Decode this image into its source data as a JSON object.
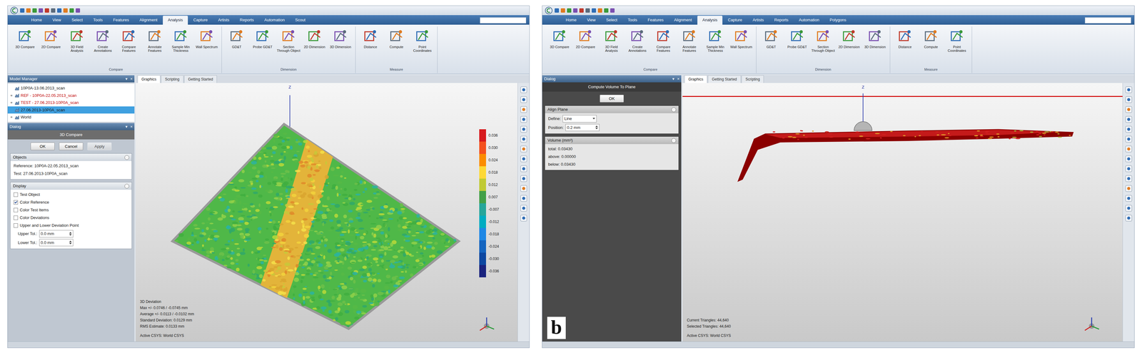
{
  "panel_a": {
    "menu_tabs": [
      {
        "label": "Home",
        "selected": false
      },
      {
        "label": "View",
        "selected": false
      },
      {
        "label": "Select",
        "selected": false
      },
      {
        "label": "Tools",
        "selected": false
      },
      {
        "label": "Features",
        "selected": false
      },
      {
        "label": "Alignment",
        "selected": false
      },
      {
        "label": "Analysis",
        "selected": true
      },
      {
        "label": "Capture",
        "selected": false
      },
      {
        "label": "Artists",
        "selected": false
      },
      {
        "label": "Reports",
        "selected": false
      },
      {
        "label": "Automation",
        "selected": false
      },
      {
        "label": "Scout",
        "selected": false
      }
    ],
    "ribbon_groups": [
      {
        "title": "Compare",
        "buttons": [
          "3D Compare",
          "2D Compare",
          "3D Field Analysis",
          "Create Annotations",
          "Compare Features",
          "Annotate Features",
          "Sample Min Thickness",
          "Wall Spectrum"
        ]
      },
      {
        "title": "Dimension",
        "buttons": [
          "GD&T",
          "Probe GD&T",
          "Section Through Object",
          "2D Dimension",
          "3D Dimension"
        ]
      },
      {
        "title": "Measure",
        "buttons": [
          "Distance",
          "Compute",
          "Point Coordinates"
        ]
      }
    ],
    "model_manager": {
      "title": "Model Manager",
      "controls": [
        "▾",
        "×"
      ],
      "items": [
        {
          "label": "10P0A-13.06.2013_scan",
          "color": "#1a1a1a",
          "selected": false
        },
        {
          "label": "REF - 10P0A-22.05.2013_scan",
          "color": "#c00000",
          "selected": false,
          "expander": "+"
        },
        {
          "label": "TEST - 27.06.2013-10P0A_scan",
          "color": "#c00000",
          "selected": false,
          "expander": "+"
        },
        {
          "label": "27.06.2013-10P0A_scan",
          "color": "#1a1a1a",
          "selected": true
        },
        {
          "label": "World",
          "color": "#1a1a1a",
          "selected": false,
          "expander": "+"
        }
      ]
    },
    "dialog": {
      "title": "Dialog",
      "controls": [
        "▾",
        "×"
      ],
      "name": "3D Compare",
      "buttons": [
        {
          "label": "OK",
          "disabled": false
        },
        {
          "label": "Cancel",
          "disabled": false
        },
        {
          "label": "Apply",
          "disabled": true
        }
      ],
      "sections": [
        {
          "title": "Objects",
          "rows": [
            {
              "kind": "text",
              "label": "Reference: 10P0A-22.05.2013_scan"
            },
            {
              "kind": "text",
              "label": "Test: 27.06.2013-10P0A_scan"
            }
          ]
        },
        {
          "title": "Display",
          "rows": [
            {
              "kind": "checkbox",
              "label": "Test Object",
              "checked": false
            },
            {
              "kind": "checkbox",
              "label": "Color Reference",
              "checked": true
            },
            {
              "kind": "checkbox",
              "label": "Color Test Items",
              "checked": false
            },
            {
              "kind": "checkbox",
              "label": "Color Deviations",
              "checked": false
            },
            {
              "kind": "checkbox",
              "label": "Upper and Lower Deviation Point",
              "checked": false
            },
            {
              "kind": "spin",
              "label": "Upper Tol.:",
              "value": "0.0 mm"
            },
            {
              "kind": "spin",
              "label": "Lower Tol.:",
              "value": "0.0 mm"
            }
          ]
        }
      ]
    },
    "graphics_tabs": [
      {
        "label": "Graphics",
        "selected": true
      },
      {
        "label": "Scripting",
        "selected": false
      },
      {
        "label": "Getting Started",
        "selected": false
      }
    ],
    "axis_label": "Z",
    "legend": [
      {
        "value": "0.036",
        "color": "#d7191c"
      },
      {
        "value": "0.030",
        "color": "#f4511e"
      },
      {
        "value": "0.024",
        "color": "#fb8c00"
      },
      {
        "value": "0.018",
        "color": "#fdd835"
      },
      {
        "value": "0.012",
        "color": "#c0ca33"
      },
      {
        "value": "0.007",
        "color": "#43a047"
      },
      {
        "value": "-0.007",
        "color": "#26a69a"
      },
      {
        "value": "-0.012",
        "color": "#00acc1"
      },
      {
        "value": "-0.018",
        "color": "#1e88e5"
      },
      {
        "value": "-0.024",
        "color": "#1565c0"
      },
      {
        "value": "-0.030",
        "color": "#0d47a1"
      },
      {
        "value": "-0.036",
        "color": "#1a237e"
      }
    ],
    "stats": [
      "3D Deviation",
      "Max +/- 0.0746 / -0.0745 mm",
      "Average +/- 0.0113 / -0.0102 mm",
      "Standard Deviation: 0.0129 mm",
      "RMS Estimate: 0.0133 mm"
    ],
    "footer": "Active CSYS: World CSYS"
  },
  "panel_b": {
    "menu_tabs": [
      {
        "label": "Home",
        "selected": false
      },
      {
        "label": "View",
        "selected": false
      },
      {
        "label": "Select",
        "selected": false
      },
      {
        "label": "Tools",
        "selected": false
      },
      {
        "label": "Features",
        "selected": false
      },
      {
        "label": "Alignment",
        "selected": false
      },
      {
        "label": "Analysis",
        "selected": true
      },
      {
        "label": "Capture",
        "selected": false
      },
      {
        "label": "Artists",
        "selected": false
      },
      {
        "label": "Reports",
        "selected": false
      },
      {
        "label": "Automation",
        "selected": false
      },
      {
        "label": "Polygons",
        "selected": false
      }
    ],
    "ribbon_groups": [
      {
        "title": "Compare",
        "buttons": [
          "3D Compare",
          "2D Compare",
          "3D Field Analysis",
          "Create Annotations",
          "Compare Features",
          "Annotate Features",
          "Sample Min Thickness",
          "Wall Spectrum"
        ]
      },
      {
        "title": "Dimension",
        "buttons": [
          "GD&T",
          "Probe GD&T",
          "Section Through Object",
          "2D Dimension",
          "3D Dimension"
        ]
      },
      {
        "title": "Measure",
        "buttons": [
          "Distance",
          "Compute",
          "Point Coordinates"
        ]
      }
    ],
    "dialog": {
      "title": "Dialog",
      "controls": [
        "▾",
        "×"
      ],
      "name": "Compute Volume To Plane",
      "buttons": [
        {
          "label": "OK",
          "disabled": false
        }
      ],
      "sections": [
        {
          "title": "Align Plane",
          "rows": [
            {
              "kind": "select",
              "label": "Define:",
              "value": "Line"
            },
            {
              "kind": "spin",
              "label": "Position:",
              "value": "0.2 mm"
            }
          ]
        },
        {
          "title": "Volume (mm³)",
          "rows": [
            {
              "kind": "text",
              "label": "total: 0.03430"
            },
            {
              "kind": "text",
              "label": "above: 0.00000"
            },
            {
              "kind": "text",
              "label": "below: 0.03430"
            }
          ]
        }
      ]
    },
    "graphics_tabs": [
      {
        "label": "Graphics",
        "selected": true
      },
      {
        "label": "Getting Started",
        "selected": false
      },
      {
        "label": "Scripting",
        "selected": false
      }
    ],
    "axis_label": "Z",
    "stats": [
      "Current Triangles: 44,640",
      "Selected Triangles: 44,640"
    ],
    "footer": "Active CSYS: World CSYS",
    "figure_label": "b"
  }
}
